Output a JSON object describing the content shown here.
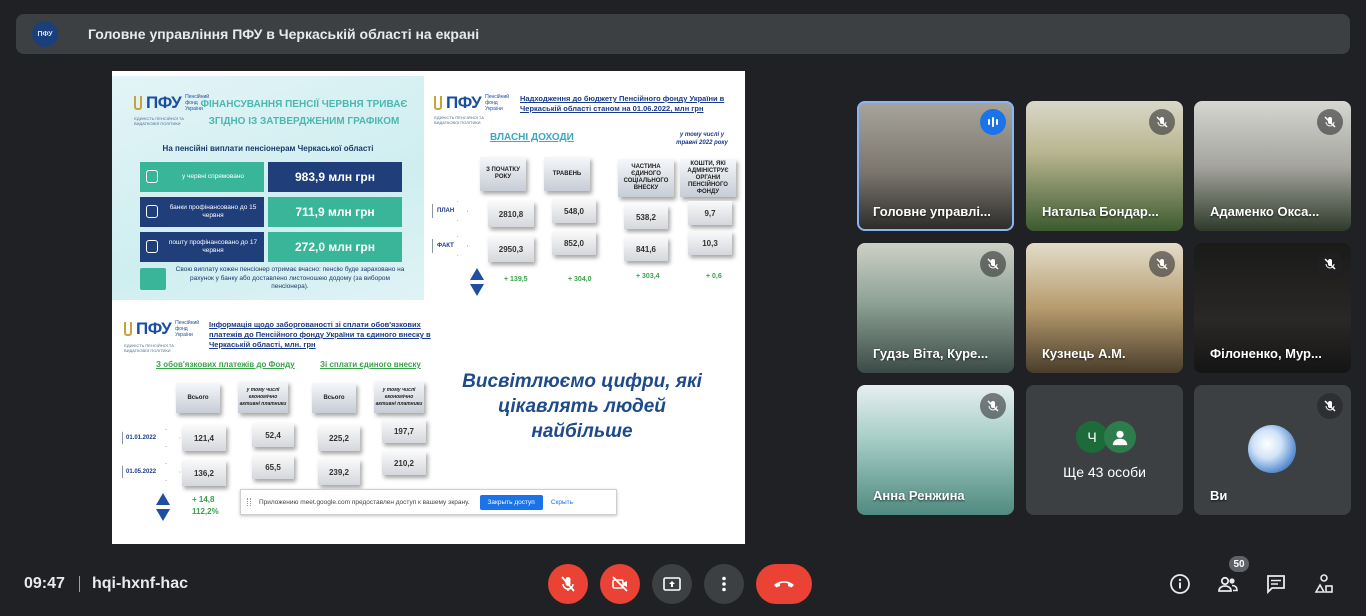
{
  "banner": {
    "title": "Головне управління ПФУ в Черкаській області на екрані"
  },
  "slide": {
    "logo_text": "ПФУ",
    "logo_fund": "Пенсійний фонд України",
    "logo_sub": "ЄДИНІСТЬ ПЕНСІЙНОЇ ТА ВИДАТКОВОЇ ПОЛІТИКИ",
    "q1": {
      "title": "ФІНАНСУВАННЯ ПЕНСІЇ ЧЕРВНЯ ТРИВАЄ ЗГІДНО ІЗ ЗАТВЕРДЖЕНИМ ГРАФІКОМ",
      "heading": "На пенсійні виплати пенсіонерам Черкаської області",
      "rows": [
        {
          "label": "у червні спрямовано",
          "value": "983,9 млн грн"
        },
        {
          "label": "банки профінансовано до 15 червня",
          "value": "711,9 млн грн"
        },
        {
          "label": "пошту профінансовано до 17 червня",
          "value": "272,0 млн грн"
        }
      ],
      "note": "Свою виплату кожен пенсіонер отримає вчасно: пенсію буде зараховано на рахунок у банку або доставлено листоношею додому (за вибором пенсіонера)."
    },
    "q2": {
      "title": "Надходження до бюджету Пенсійного фонду України в Черкаській області станом на 01.06.2022, млн грн",
      "own_income": "ВЛАСНІ ДОХОДИ",
      "may_note": "у тому числі у травні 2022 року",
      "col_headers": [
        "З ПОЧАТКУ РОКУ",
        "ТРАВЕНЬ",
        "ЧАСТИНА ЄДИНОГО СОЦІАЛЬНОГО ВНЕСКУ",
        "КОШТИ, ЯКІ АДМІНІСТРУЄ ОРГАНИ ПЕНСІЙНОГО ФОНДУ"
      ],
      "row_labels": [
        "ПЛАН",
        "ФАКТ"
      ],
      "plan": [
        "2810,8",
        "548,0",
        "538,2",
        "9,7"
      ],
      "fact": [
        "2950,3",
        "852,0",
        "841,6",
        "10,3"
      ],
      "deltas": [
        "+ 139,5",
        "+ 304,0",
        "+ 303,4",
        "+ 0,6"
      ]
    },
    "q3": {
      "title": "Інформація щодо заборгованості зі сплати обов'язкових платежів до Пенсійного фонду України та єдиного внеску в Черкаській області, млн. грн",
      "sub1": "З обов'язкових платежів до Фонду",
      "sub2": "Зі сплати єдиного внеску",
      "col_headers": [
        "Всього",
        "у тому числі економічно активні платники",
        "Всього",
        "у тому числі економічно активні платники"
      ],
      "dates": [
        "01.01.2022",
        "01.05.2022"
      ],
      "row1": [
        "121,4",
        "52,4",
        "225,2",
        "197,7"
      ],
      "row2": [
        "136,2",
        "65,5",
        "239,2",
        "210,2"
      ],
      "delta_value": "+ 14,8",
      "delta_pct": "112,2%"
    },
    "tagline": "Висвітлюємо цифри, які цікавлять людей найбільше",
    "share_bar": {
      "text": "Приложению meet.google.com предоставлен доступ к вашему экрану.",
      "stop_label": "Закрыть доступ",
      "hide_label": "Скрыть"
    }
  },
  "participants": [
    {
      "name": "Головне управлі...",
      "mic": "speaking",
      "active": true
    },
    {
      "name": "Натальа Бондар...",
      "mic": "muted"
    },
    {
      "name": "Адаменко Оксa...",
      "mic": "muted"
    },
    {
      "name": "Гудзь Віта, Куре...",
      "mic": "muted"
    },
    {
      "name": "Кузнець А.М.",
      "mic": "muted"
    },
    {
      "name": "Філоненко, Мур...",
      "mic": "muted"
    },
    {
      "name": "Анна Ренжина",
      "mic": "muted"
    },
    {
      "name": "Ви",
      "mic": "muted"
    }
  ],
  "more_tile": {
    "avatar_letter": "Ч",
    "label": "Ще 43 особи"
  },
  "bottom_bar": {
    "time": "09:47",
    "meeting_code": "hqi-hxnf-hac",
    "participant_count": "50",
    "controls": [
      "mic-off-icon",
      "camera-off-icon",
      "present-screen-icon",
      "more-vert-icon",
      "hang-up-icon"
    ],
    "right_icons": [
      "info-icon",
      "people-icon",
      "chat-icon",
      "activities-icon"
    ]
  },
  "colors": {
    "background": "#202124",
    "panel": "#3c4043",
    "danger": "#ea4335",
    "accent": "#8ab4f8",
    "speaking": "#1a73e8"
  }
}
